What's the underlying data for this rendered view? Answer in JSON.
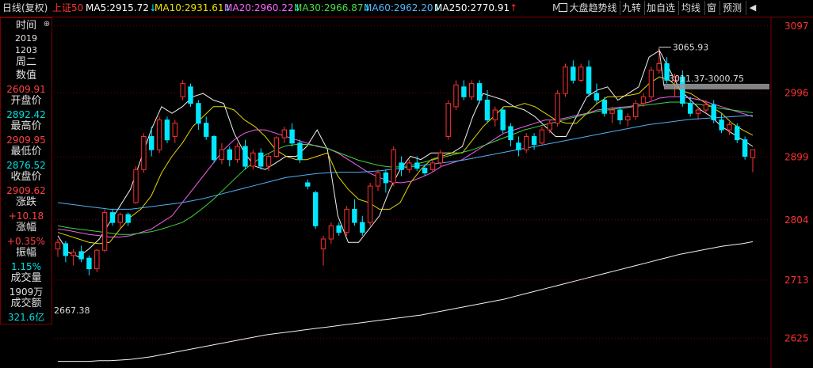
{
  "header": {
    "period": "日线(复权)",
    "index_name": "上证50",
    "ma": [
      {
        "label": "MA5:",
        "value": "2915.72",
        "arrow": "↓",
        "color": "#ffffff"
      },
      {
        "label": "MA10:",
        "value": "2931.61",
        "arrow": "↓",
        "color": "#f0e000"
      },
      {
        "label": "MA20:",
        "value": "2960.22",
        "arrow": "↓",
        "color": "#ff66ff"
      },
      {
        "label": "MA30:",
        "value": "2966.87",
        "arrow": "↓",
        "color": "#44e044"
      },
      {
        "label": "MA60:",
        "value": "2962.20",
        "arrow": "↓",
        "color": "#55b8ff"
      },
      {
        "label": "MA250:",
        "value": "2770.91",
        "arrow": "↑",
        "color": "#ffffff"
      }
    ],
    "trailing_text": "M",
    "buttons": {
      "trend_line": "大盘趋势线",
      "nine_turn": "九转",
      "add_watch": "加自选",
      "avg_line": "均线",
      "window": "窗",
      "forecast": "预测"
    },
    "icons": {
      "back": "back-icon",
      "checkbox": "checkbox-icon"
    }
  },
  "info_panel": {
    "time_label": "时间",
    "year": "2019",
    "date": "1203",
    "weekday": "周二",
    "value_label": "数值",
    "value": "2609.91",
    "open_label": "开盘价",
    "open": "2892.42",
    "high_label": "最高价",
    "high": "2909.95",
    "low_label": "最低价",
    "low": "2876.52",
    "close_label": "收盘价",
    "close": "2909.62",
    "change_label": "涨跌",
    "change": "+10.18",
    "change_pct_label": "涨幅",
    "change_pct": "+0.35%",
    "amplitude_label": "振幅",
    "amplitude": "1.15%",
    "volume_label": "成交量",
    "volume": "1909万",
    "turnover_label": "成交额",
    "turnover": "321.6亿",
    "colors": {
      "down": "#00e0e0",
      "up": "#ff4040",
      "neutral": "#e0e0e0"
    }
  },
  "chart_data": {
    "type": "candlestick",
    "ylim": [
      2580,
      3110
    ],
    "y_ticks": [
      "3097",
      "2996",
      "2899",
      "2804",
      "2713",
      "2625"
    ],
    "annotations": {
      "high_label": "3065.93",
      "low_label": "2667.38",
      "range_label": "3011.37-3000.75"
    },
    "colors": {
      "up": "#ff3030",
      "down": "#00e8ff",
      "grid": "#7a0000",
      "axis_text": "#ff3030"
    },
    "series": [
      {
        "name": "MA5",
        "color": "#ffffff",
        "values": [
          2780,
          2755,
          2748,
          2760,
          2775,
          2800,
          2825,
          2850,
          2895,
          2940,
          2975,
          2965,
          2975,
          2990,
          2995,
          2985,
          2980,
          2935,
          2905,
          2885,
          2880,
          2890,
          2900,
          2900,
          2915,
          2940,
          2910,
          2810,
          2770,
          2770,
          2790,
          2810,
          2850,
          2880,
          2900,
          2895,
          2905,
          2905,
          2905,
          2915,
          2960,
          2995,
          2990,
          2985,
          2975,
          2970,
          2960,
          2945,
          2930,
          2930,
          2960,
          2990,
          3000,
          3005,
          2985,
          2995,
          3005,
          3050,
          3060,
          3030,
          3000,
          2985,
          2970,
          2960,
          2945,
          2935,
          2925,
          2915
        ]
      },
      {
        "name": "MA10",
        "color": "#f0e000",
        "values": [
          2785,
          2780,
          2775,
          2770,
          2768,
          2770,
          2790,
          2808,
          2820,
          2840,
          2875,
          2900,
          2920,
          2945,
          2960,
          2975,
          2975,
          2970,
          2955,
          2945,
          2930,
          2910,
          2900,
          2895,
          2895,
          2900,
          2905,
          2870,
          2850,
          2835,
          2830,
          2820,
          2820,
          2830,
          2860,
          2880,
          2895,
          2900,
          2905,
          2905,
          2925,
          2945,
          2960,
          2975,
          2975,
          2980,
          2975,
          2965,
          2955,
          2950,
          2950,
          2965,
          2980,
          2990,
          2990,
          2992,
          2995,
          3010,
          3020,
          3015,
          3000,
          2995,
          2985,
          2975,
          2965,
          2950,
          2940,
          2932
        ]
      },
      {
        "name": "MA20",
        "color": "#ff66ff",
        "values": [
          2790,
          2788,
          2785,
          2782,
          2780,
          2778,
          2778,
          2780,
          2785,
          2790,
          2800,
          2810,
          2830,
          2850,
          2870,
          2890,
          2910,
          2925,
          2935,
          2940,
          2940,
          2935,
          2930,
          2925,
          2920,
          2915,
          2912,
          2905,
          2895,
          2885,
          2875,
          2868,
          2862,
          2860,
          2862,
          2868,
          2875,
          2885,
          2890,
          2895,
          2905,
          2915,
          2925,
          2935,
          2940,
          2945,
          2950,
          2955,
          2955,
          2958,
          2962,
          2965,
          2970,
          2972,
          2974,
          2975,
          2978,
          2982,
          2988,
          2990,
          2990,
          2988,
          2985,
          2980,
          2975,
          2970,
          2965,
          2960
        ]
      },
      {
        "name": "MA30",
        "color": "#44e044",
        "values": [
          2795,
          2792,
          2790,
          2788,
          2786,
          2784,
          2782,
          2782,
          2784,
          2786,
          2790,
          2795,
          2800,
          2810,
          2822,
          2835,
          2850,
          2865,
          2880,
          2892,
          2902,
          2910,
          2916,
          2918,
          2918,
          2916,
          2912,
          2906,
          2900,
          2894,
          2890,
          2886,
          2884,
          2884,
          2886,
          2890,
          2894,
          2898,
          2902,
          2906,
          2910,
          2916,
          2922,
          2928,
          2934,
          2940,
          2944,
          2948,
          2952,
          2956,
          2960,
          2964,
          2968,
          2970,
          2972,
          2974,
          2976,
          2978,
          2980,
          2982,
          2982,
          2980,
          2978,
          2975,
          2972,
          2970,
          2968,
          2966
        ]
      },
      {
        "name": "MA60",
        "color": "#55b8ff",
        "values": [
          2830,
          2828,
          2826,
          2824,
          2822,
          2820,
          2820,
          2820,
          2822,
          2824,
          2826,
          2828,
          2830,
          2833,
          2836,
          2840,
          2844,
          2848,
          2852,
          2856,
          2860,
          2864,
          2868,
          2870,
          2872,
          2874,
          2875,
          2876,
          2876,
          2876,
          2877,
          2878,
          2880,
          2882,
          2884,
          2886,
          2888,
          2890,
          2892,
          2894,
          2897,
          2900,
          2903,
          2906,
          2909,
          2912,
          2915,
          2918,
          2921,
          2924,
          2927,
          2930,
          2933,
          2936,
          2939,
          2942,
          2945,
          2948,
          2950,
          2952,
          2954,
          2956,
          2957,
          2958,
          2959,
          2960,
          2961,
          2962
        ]
      },
      {
        "name": "MA250",
        "color": "#ffffff",
        "values": [
          2590,
          2590,
          2590,
          2590,
          2591,
          2591,
          2592,
          2593,
          2595,
          2597,
          2600,
          2603,
          2606,
          2609,
          2612,
          2615,
          2618,
          2621,
          2624,
          2627,
          2630,
          2632,
          2634,
          2636,
          2638,
          2640,
          2642,
          2644,
          2646,
          2648,
          2650,
          2652,
          2654,
          2656,
          2658,
          2660,
          2663,
          2666,
          2669,
          2672,
          2675,
          2678,
          2681,
          2684,
          2688,
          2692,
          2696,
          2700,
          2704,
          2708,
          2712,
          2716,
          2720,
          2724,
          2728,
          2732,
          2736,
          2740,
          2744,
          2748,
          2752,
          2755,
          2758,
          2761,
          2764,
          2766,
          2768,
          2771
        ]
      }
    ],
    "candles": [
      {
        "o": 2760,
        "h": 2775,
        "l": 2748,
        "c": 2770
      },
      {
        "o": 2768,
        "h": 2772,
        "l": 2740,
        "c": 2750
      },
      {
        "o": 2750,
        "h": 2760,
        "l": 2735,
        "c": 2755
      },
      {
        "o": 2756,
        "h": 2765,
        "l": 2740,
        "c": 2745
      },
      {
        "o": 2746,
        "h": 2750,
        "l": 2720,
        "c": 2730
      },
      {
        "o": 2730,
        "h": 2760,
        "l": 2725,
        "c": 2758
      },
      {
        "o": 2758,
        "h": 2820,
        "l": 2755,
        "c": 2815
      },
      {
        "o": 2815,
        "h": 2820,
        "l": 2795,
        "c": 2800
      },
      {
        "o": 2800,
        "h": 2815,
        "l": 2790,
        "c": 2812
      },
      {
        "o": 2812,
        "h": 2815,
        "l": 2795,
        "c": 2800
      },
      {
        "o": 2830,
        "h": 2885,
        "l": 2828,
        "c": 2880
      },
      {
        "o": 2880,
        "h": 2935,
        "l": 2875,
        "c": 2930
      },
      {
        "o": 2930,
        "h": 2945,
        "l": 2900,
        "c": 2910
      },
      {
        "o": 2910,
        "h": 2960,
        "l": 2905,
        "c": 2955
      },
      {
        "o": 2955,
        "h": 2960,
        "l": 2920,
        "c": 2925
      },
      {
        "o": 2930,
        "h": 2955,
        "l": 2920,
        "c": 2950
      },
      {
        "o": 2990,
        "h": 3015,
        "l": 2985,
        "c": 3010
      },
      {
        "o": 3005,
        "h": 3010,
        "l": 2975,
        "c": 2980
      },
      {
        "o": 2980,
        "h": 2985,
        "l": 2940,
        "c": 2950
      },
      {
        "o": 2950,
        "h": 2960,
        "l": 2925,
        "c": 2930
      },
      {
        "o": 2930,
        "h": 2932,
        "l": 2890,
        "c": 2895
      },
      {
        "o": 2895,
        "h": 2920,
        "l": 2888,
        "c": 2910
      },
      {
        "o": 2910,
        "h": 2915,
        "l": 2885,
        "c": 2895
      },
      {
        "o": 2895,
        "h": 2920,
        "l": 2890,
        "c": 2915
      },
      {
        "o": 2915,
        "h": 2925,
        "l": 2880,
        "c": 2885
      },
      {
        "o": 2885,
        "h": 2910,
        "l": 2880,
        "c": 2905
      },
      {
        "o": 2905,
        "h": 2912,
        "l": 2880,
        "c": 2885
      },
      {
        "o": 2885,
        "h": 2905,
        "l": 2878,
        "c": 2900
      },
      {
        "o": 2900,
        "h": 2930,
        "l": 2898,
        "c": 2928
      },
      {
        "o": 2928,
        "h": 2945,
        "l": 2920,
        "c": 2940
      },
      {
        "o": 2940,
        "h": 2950,
        "l": 2915,
        "c": 2920
      },
      {
        "o": 2920,
        "h": 2925,
        "l": 2890,
        "c": 2895
      },
      {
        "o": 2860,
        "h": 2865,
        "l": 2850,
        "c": 2855
      },
      {
        "o": 2845,
        "h": 2848,
        "l": 2790,
        "c": 2795
      },
      {
        "o": 2760,
        "h": 2780,
        "l": 2735,
        "c": 2775
      },
      {
        "o": 2775,
        "h": 2800,
        "l": 2768,
        "c": 2795
      },
      {
        "o": 2795,
        "h": 2800,
        "l": 2780,
        "c": 2785
      },
      {
        "o": 2785,
        "h": 2825,
        "l": 2780,
        "c": 2820
      },
      {
        "o": 2820,
        "h": 2835,
        "l": 2795,
        "c": 2800
      },
      {
        "o": 2800,
        "h": 2810,
        "l": 2780,
        "c": 2785
      },
      {
        "o": 2800,
        "h": 2860,
        "l": 2795,
        "c": 2855
      },
      {
        "o": 2855,
        "h": 2880,
        "l": 2848,
        "c": 2875
      },
      {
        "o": 2875,
        "h": 2880,
        "l": 2845,
        "c": 2860
      },
      {
        "o": 2860,
        "h": 2915,
        "l": 2855,
        "c": 2910
      },
      {
        "o": 2890,
        "h": 2900,
        "l": 2870,
        "c": 2880
      },
      {
        "o": 2880,
        "h": 2895,
        "l": 2875,
        "c": 2890
      },
      {
        "o": 2890,
        "h": 2900,
        "l": 2878,
        "c": 2882
      },
      {
        "o": 2882,
        "h": 2888,
        "l": 2870,
        "c": 2875
      },
      {
        "o": 2880,
        "h": 2895,
        "l": 2876,
        "c": 2890
      },
      {
        "o": 2890,
        "h": 2910,
        "l": 2885,
        "c": 2905
      },
      {
        "o": 2930,
        "h": 2985,
        "l": 2925,
        "c": 2980
      },
      {
        "o": 2975,
        "h": 3015,
        "l": 2970,
        "c": 3008
      },
      {
        "o": 3005,
        "h": 3015,
        "l": 2985,
        "c": 2990
      },
      {
        "o": 2990,
        "h": 3015,
        "l": 2985,
        "c": 3010
      },
      {
        "o": 3010,
        "h": 3015,
        "l": 2980,
        "c": 2985
      },
      {
        "o": 2985,
        "h": 3000,
        "l": 2950,
        "c": 2955
      },
      {
        "o": 2955,
        "h": 2975,
        "l": 2945,
        "c": 2970
      },
      {
        "o": 2970,
        "h": 2975,
        "l": 2935,
        "c": 2940
      },
      {
        "o": 2945,
        "h": 2950,
        "l": 2915,
        "c": 2925
      },
      {
        "o": 2920,
        "h": 2930,
        "l": 2900,
        "c": 2910
      },
      {
        "o": 2910,
        "h": 2935,
        "l": 2905,
        "c": 2930
      },
      {
        "o": 2930,
        "h": 2935,
        "l": 2910,
        "c": 2918
      },
      {
        "o": 2920,
        "h": 2945,
        "l": 2918,
        "c": 2940
      },
      {
        "o": 2940,
        "h": 2955,
        "l": 2935,
        "c": 2950
      },
      {
        "o": 2950,
        "h": 3000,
        "l": 2945,
        "c": 2995
      },
      {
        "o": 2995,
        "h": 3040,
        "l": 2990,
        "c": 3035
      },
      {
        "o": 3035,
        "h": 3045,
        "l": 3010,
        "c": 3015
      },
      {
        "o": 3015,
        "h": 3040,
        "l": 3012,
        "c": 3035
      },
      {
        "o": 3035,
        "h": 3045,
        "l": 2990,
        "c": 2995
      },
      {
        "o": 2995,
        "h": 3010,
        "l": 2980,
        "c": 2985
      },
      {
        "o": 2985,
        "h": 2990,
        "l": 2960,
        "c": 2965
      },
      {
        "o": 2965,
        "h": 2975,
        "l": 2950,
        "c": 2970
      },
      {
        "o": 2970,
        "h": 2975,
        "l": 2948,
        "c": 2955
      },
      {
        "o": 2955,
        "h": 2965,
        "l": 2945,
        "c": 2960
      },
      {
        "o": 2960,
        "h": 2985,
        "l": 2955,
        "c": 2980
      },
      {
        "o": 2980,
        "h": 2995,
        "l": 2975,
        "c": 2990
      },
      {
        "o": 2990,
        "h": 3035,
        "l": 2985,
        "c": 3030
      },
      {
        "o": 3030,
        "h": 3065,
        "l": 3025,
        "c": 3040
      },
      {
        "o": 3040,
        "h": 3050,
        "l": 3010,
        "c": 3015
      },
      {
        "o": 3015,
        "h": 3025,
        "l": 2990,
        "c": 3020
      },
      {
        "o": 3020,
        "h": 3030,
        "l": 2975,
        "c": 2980
      },
      {
        "o": 2980,
        "h": 2990,
        "l": 2960,
        "c": 2965
      },
      {
        "o": 2965,
        "h": 2975,
        "l": 2955,
        "c": 2970
      },
      {
        "o": 2970,
        "h": 2985,
        "l": 2965,
        "c": 2978
      },
      {
        "o": 2978,
        "h": 2985,
        "l": 2950,
        "c": 2955
      },
      {
        "o": 2955,
        "h": 2965,
        "l": 2935,
        "c": 2940
      },
      {
        "o": 2940,
        "h": 2952,
        "l": 2932,
        "c": 2948
      },
      {
        "o": 2945,
        "h": 2950,
        "l": 2920,
        "c": 2925
      },
      {
        "o": 2925,
        "h": 2930,
        "l": 2895,
        "c": 2900
      },
      {
        "o": 2898,
        "h": 2910,
        "l": 2876,
        "c": 2910
      }
    ]
  }
}
